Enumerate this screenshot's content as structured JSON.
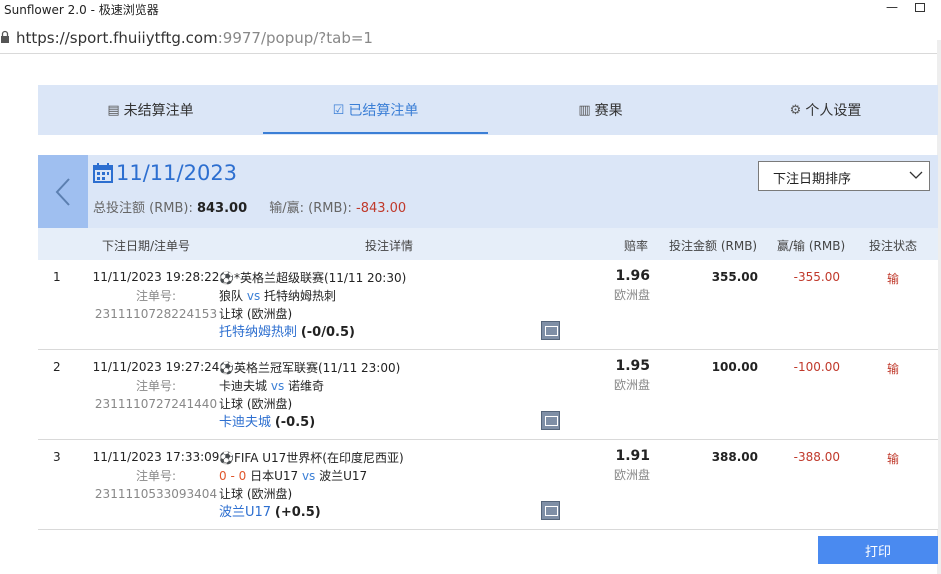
{
  "window": {
    "title": "Sunflower 2.0 - 极速浏览器",
    "min_glyph": "—"
  },
  "address": {
    "url_main": "https://sport.fhuiiytftg.com",
    "url_rest": ":9977/popup/?tab=1"
  },
  "tabs": [
    {
      "label": "未结算注单",
      "icon": "list-icon"
    },
    {
      "label": "已结算注单",
      "icon": "checked-list-icon",
      "active": true
    },
    {
      "label": "赛果",
      "icon": "scoreboard-icon"
    },
    {
      "label": "个人设置",
      "icon": "gear-icon"
    }
  ],
  "header": {
    "date": "11/11/2023",
    "total_label": "总投注额 (RMB):",
    "total_value": "843.00",
    "winloss_label": "输/赢: (RMB):",
    "winloss_value": "-843.00",
    "sort_value": "下注日期排序"
  },
  "columns": {
    "date": "下注日期/注单号",
    "detail": "投注详情",
    "odds": "赔率",
    "stake": "投注金额 (RMB)",
    "winloss": "赢/输 (RMB)",
    "status": "投注状态"
  },
  "bets": [
    {
      "index": "1",
      "datetime": "11/11/2023 19:28:22",
      "ticket_label": "注单号:",
      "ticket_no": "2311110728224153",
      "league": "*英格兰超级联赛(11/11 20:30)",
      "home": "狼队",
      "vs": "vs",
      "away": "托特纳姆热刺",
      "score": "",
      "market": "让球 (欧洲盘)",
      "pick": "托特纳姆热刺",
      "handicap": "(-0/0.5)",
      "odds": "1.96",
      "odds_type": "欧洲盘",
      "stake": "355.00",
      "winloss": "-355.00",
      "status": "输"
    },
    {
      "index": "2",
      "datetime": "11/11/2023 19:27:24",
      "ticket_label": "注单号:",
      "ticket_no": "2311110727241440",
      "league": "英格兰冠军联赛(11/11 23:00)",
      "home": "卡迪夫城",
      "vs": "vs",
      "away": "诺维奇",
      "score": "",
      "market": "让球 (欧洲盘)",
      "pick": "卡迪夫城",
      "handicap": "(-0.5)",
      "odds": "1.95",
      "odds_type": "欧洲盘",
      "stake": "100.00",
      "winloss": "-100.00",
      "status": "输"
    },
    {
      "index": "3",
      "datetime": "11/11/2023 17:33:09",
      "ticket_label": "注单号:",
      "ticket_no": "2311110533093404",
      "league": "FIFA U17世界杯(在印度尼西亚)",
      "home": "日本U17",
      "vs": "vs",
      "away": "波兰U17",
      "score": "0 - 0",
      "market": "让球 (欧洲盘)",
      "pick": "波兰U17",
      "handicap": "(+0.5)",
      "odds": "1.91",
      "odds_type": "欧洲盘",
      "stake": "388.00",
      "winloss": "-388.00",
      "status": "输"
    }
  ],
  "print_label": "打印",
  "colors": {
    "accent": "#3b7fd6",
    "panel": "#dbe6f7",
    "loss": "#c0392b",
    "button": "#4a8af0"
  }
}
